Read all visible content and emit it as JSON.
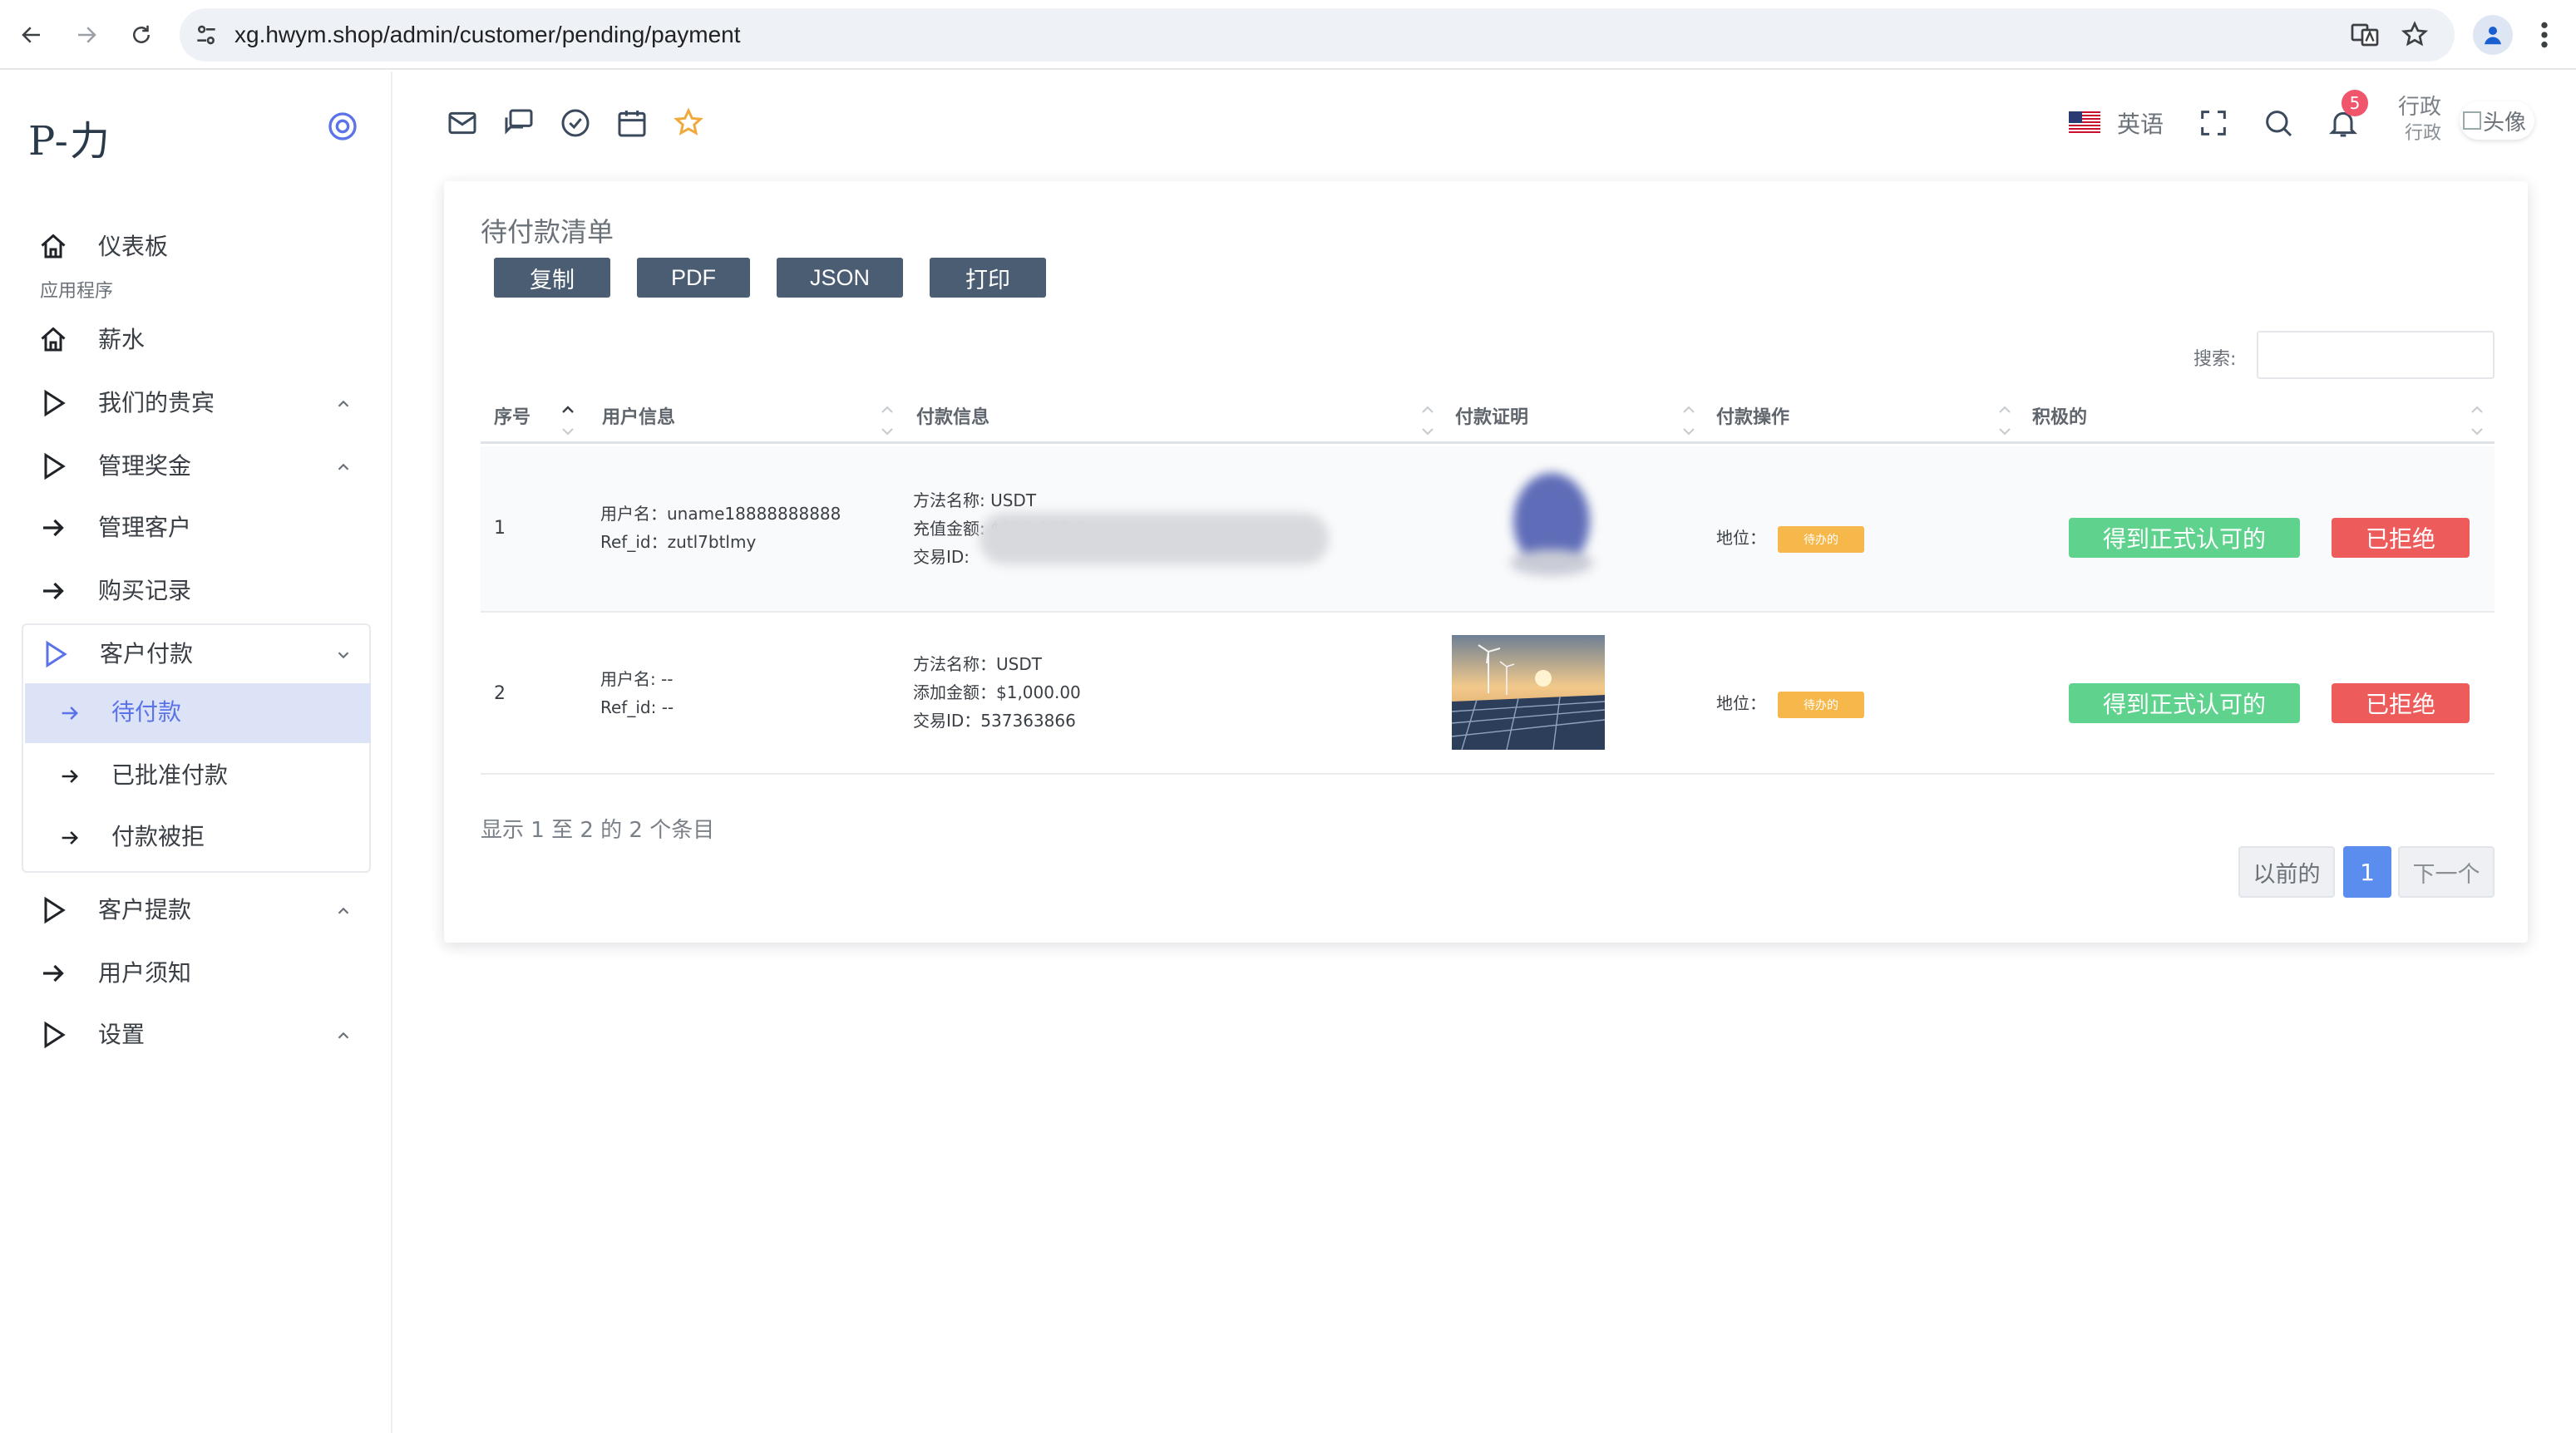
{
  "browser": {
    "url": "xg.hwym.shop/admin/customer/pending/payment"
  },
  "sidebar": {
    "brand": "P-力",
    "dashboard": "仪表板",
    "section_caption": "应用程序",
    "items": [
      {
        "label": "薪水"
      },
      {
        "label": "我们的贵宾"
      },
      {
        "label": "管理奖金"
      },
      {
        "label": "管理客户"
      },
      {
        "label": "购买记录"
      },
      {
        "label": "客户付款"
      },
      {
        "label": "客户提款"
      },
      {
        "label": "用户须知"
      },
      {
        "label": "设置"
      }
    ],
    "payments_sub": [
      {
        "label": "待付款"
      },
      {
        "label": "已批准付款"
      },
      {
        "label": "付款被拒"
      }
    ]
  },
  "topbar": {
    "language": "英语",
    "notification_count": "5",
    "user_role_top": "行政",
    "user_role_bottom": "行政",
    "avatar_alt": "头像"
  },
  "card": {
    "title": "待付款清单",
    "buttons": [
      "复制",
      "PDF",
      "JSON",
      "打印"
    ],
    "search_label": "搜索:",
    "columns": [
      "序号",
      "用户信息",
      "付款信息",
      "付款证明",
      "付款操作",
      "积极的"
    ],
    "rows": [
      {
        "index": "1",
        "username": "用户名：uname18888888888",
        "ref_id": "Ref_id：zutl7btlmy",
        "method": "方法名称: USDT",
        "amount": "充值金额: $120,000.00",
        "tx_id": "交易ID:",
        "status_label": "地位：",
        "status": "待办的",
        "approve": "得到正式认可的",
        "reject": "已拒绝"
      },
      {
        "index": "2",
        "username": "用户名: --",
        "ref_id": "Ref_id: --",
        "method": "方法名称：USDT",
        "amount": "添加金额：$1,000.00",
        "tx_id": "交易ID：537363866",
        "status_label": "地位：",
        "status": "待办的",
        "approve": "得到正式认可的",
        "reject": "已拒绝"
      }
    ],
    "info": "显示 1 至 2 的 2 个条目",
    "pagination": {
      "prev": "以前的",
      "current": "1",
      "next": "下一个"
    }
  },
  "colors": {
    "primary_button": "#4b5d73",
    "approve": "#5fd38d",
    "reject": "#ee5b5b",
    "pending_badge": "#f7b84b",
    "active_menu": "#5b73e8",
    "badge": "#f1556c"
  }
}
